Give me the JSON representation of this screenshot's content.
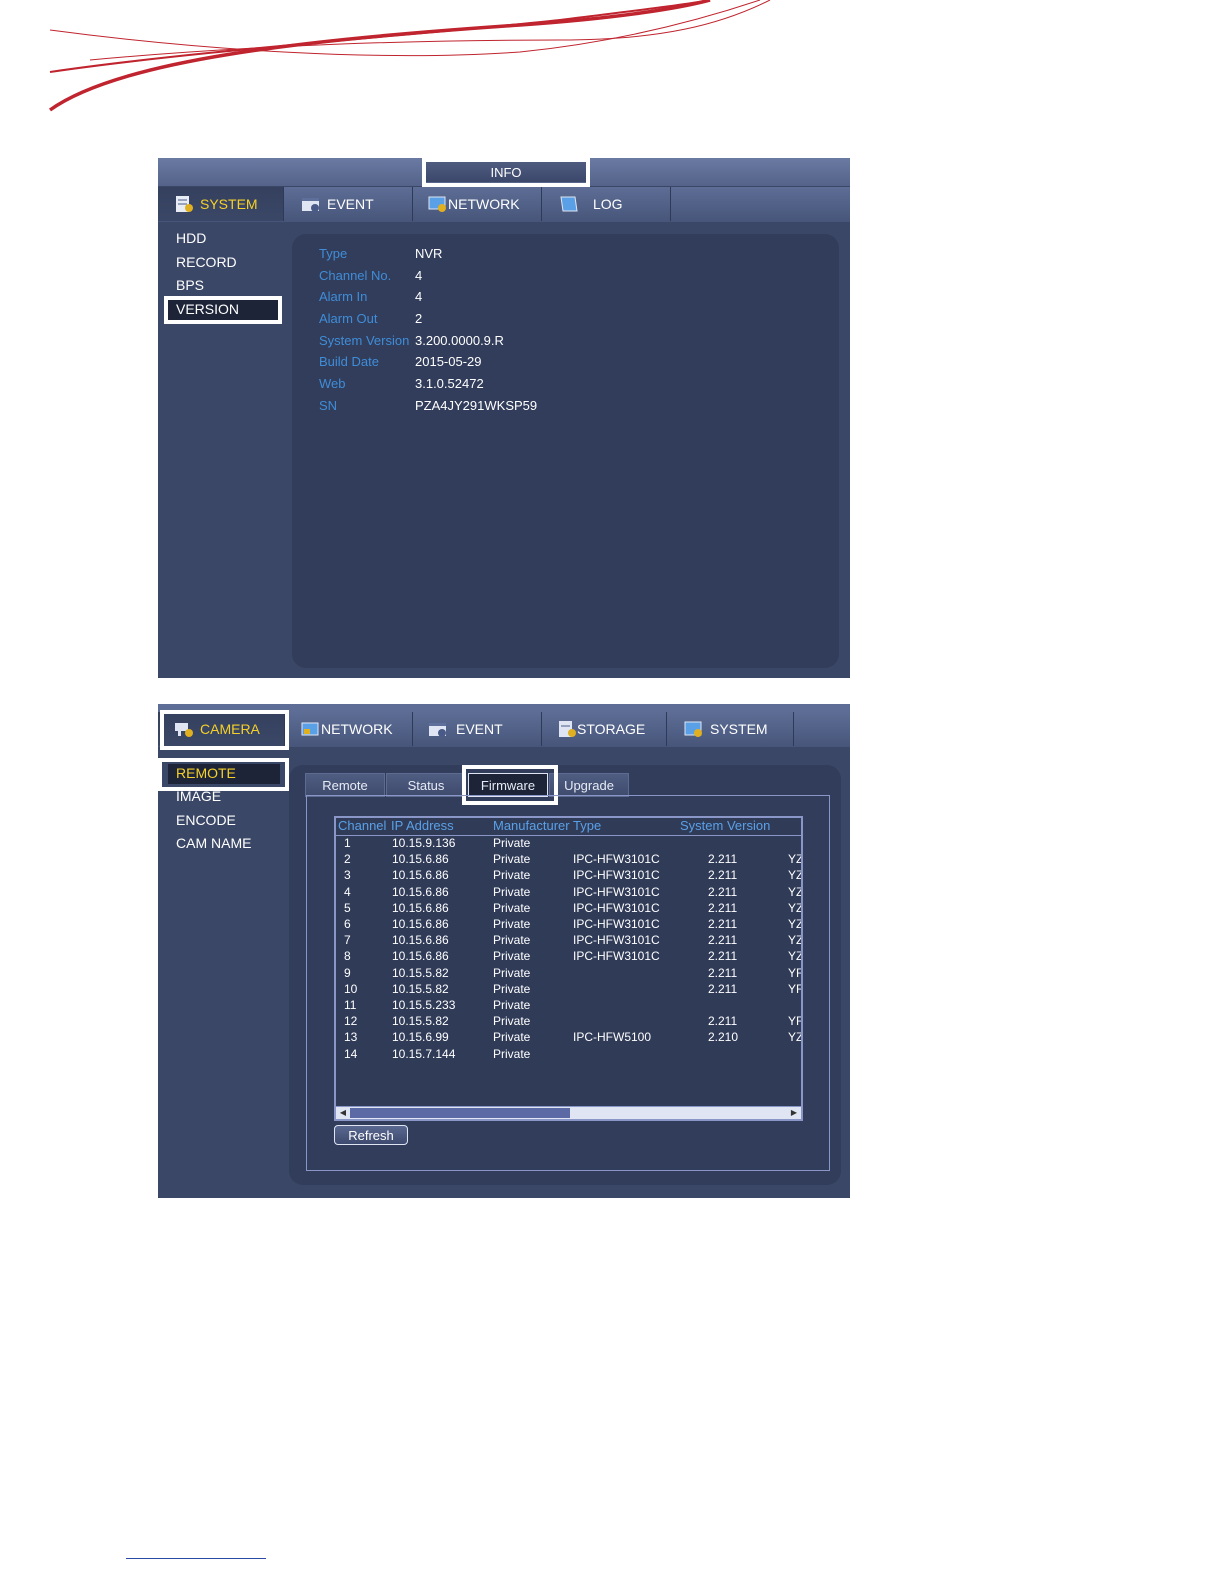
{
  "info_window": {
    "title": "INFO",
    "tabs": [
      {
        "label": "SYSTEM",
        "icon": "system-icon",
        "active": true
      },
      {
        "label": "EVENT",
        "icon": "event-icon",
        "active": false
      },
      {
        "label": "NETWORK",
        "icon": "network-icon",
        "active": false
      },
      {
        "label": "LOG",
        "icon": "log-icon",
        "active": false
      }
    ],
    "sidebar": [
      "HDD",
      "RECORD",
      "BPS",
      "VERSION"
    ],
    "selected_sidebar": "VERSION",
    "version_info": [
      {
        "label": "Type",
        "value": "NVR"
      },
      {
        "label": "Channel No.",
        "value": "4"
      },
      {
        "label": "Alarm In",
        "value": "4"
      },
      {
        "label": "Alarm Out",
        "value": "2"
      },
      {
        "label": "System Version",
        "value": "3.200.0000.9.R"
      },
      {
        "label": "Build Date",
        "value": "2015-05-29"
      },
      {
        "label": "Web",
        "value": "3.1.0.52472"
      },
      {
        "label": "SN",
        "value": "PZA4JY291WKSP59"
      }
    ]
  },
  "camera_window": {
    "tabs": [
      {
        "label": "CAMERA",
        "icon": "camera-icon",
        "active": true
      },
      {
        "label": "NETWORK",
        "icon": "network-icon",
        "active": false
      },
      {
        "label": "EVENT",
        "icon": "event-icon",
        "active": false
      },
      {
        "label": "STORAGE",
        "icon": "storage-icon",
        "active": false
      },
      {
        "label": "SYSTEM",
        "icon": "system-icon",
        "active": false
      }
    ],
    "sidebar": [
      "REMOTE",
      "IMAGE",
      "ENCODE",
      "CAM NAME"
    ],
    "selected_sidebar": "REMOTE",
    "subtabs": [
      "Remote",
      "Status",
      "Firmware",
      "Upgrade"
    ],
    "active_subtab": "Firmware",
    "table": {
      "headers": [
        "Channel",
        "IP Address",
        "Manufacturer",
        "Type",
        "System Version"
      ],
      "rows": [
        [
          "1",
          "10.15.9.136",
          "Private",
          "",
          "",
          ""
        ],
        [
          "2",
          "10.15.6.86",
          "Private",
          "IPC-HFW3101C",
          "2.211",
          "YZ"
        ],
        [
          "3",
          "10.15.6.86",
          "Private",
          "IPC-HFW3101C",
          "2.211",
          "YZ"
        ],
        [
          "4",
          "10.15.6.86",
          "Private",
          "IPC-HFW3101C",
          "2.211",
          "YZ"
        ],
        [
          "5",
          "10.15.6.86",
          "Private",
          "IPC-HFW3101C",
          "2.211",
          "YZ"
        ],
        [
          "6",
          "10.15.6.86",
          "Private",
          "IPC-HFW3101C",
          "2.211",
          "YZ"
        ],
        [
          "7",
          "10.15.6.86",
          "Private",
          "IPC-HFW3101C",
          "2.211",
          "YZ"
        ],
        [
          "8",
          "10.15.6.86",
          "Private",
          "IPC-HFW3101C",
          "2.211",
          "YZ"
        ],
        [
          "9",
          "10.15.5.82",
          "Private",
          "",
          "2.211",
          "YF"
        ],
        [
          "10",
          "10.15.5.82",
          "Private",
          "",
          "2.211",
          "YF"
        ],
        [
          "11",
          "10.15.5.233",
          "Private",
          "",
          "",
          ""
        ],
        [
          "12",
          "10.15.5.82",
          "Private",
          "",
          "2.211",
          "YF"
        ],
        [
          "13",
          "10.15.6.99",
          "Private",
          "IPC-HFW5100",
          "2.210",
          "YZ"
        ],
        [
          "14",
          "10.15.7.144",
          "Private",
          "",
          "",
          ""
        ]
      ]
    },
    "refresh_label": "Refresh"
  },
  "colors": {
    "brand_red": "#c0242e",
    "active_tab_text": "#f5d028",
    "label_blue": "#3f8dd8",
    "window_bg": "#3b4766"
  }
}
